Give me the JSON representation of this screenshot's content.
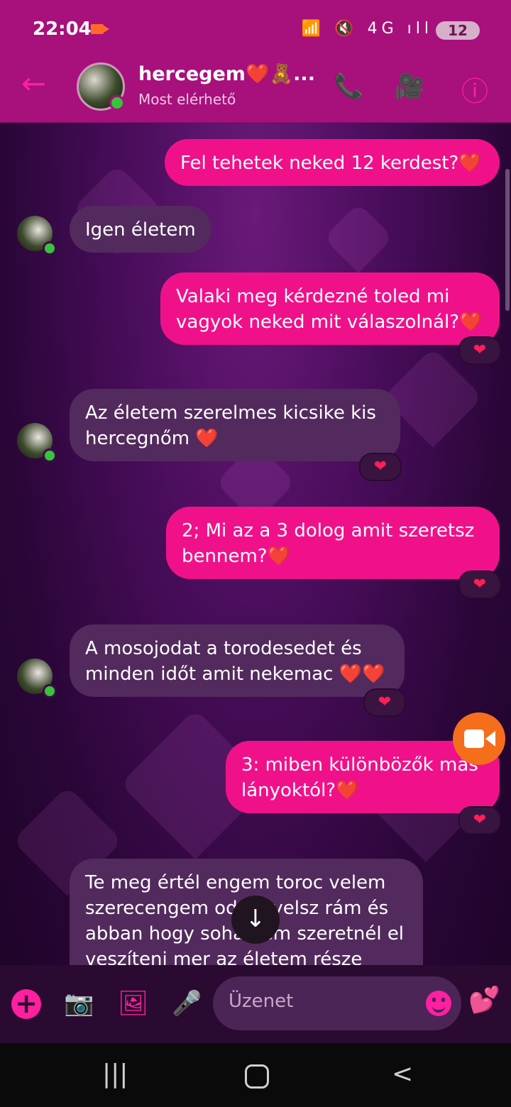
{
  "status": {
    "time": "22:04",
    "icons": "📶 🔇 4G ıll",
    "battery": "12"
  },
  "header": {
    "back_icon": "←",
    "name": "hercegem❤️🧸...",
    "status": "Most elérhető",
    "call_icon": "📞",
    "video_icon": "🎥",
    "info_icon": "ⓘ"
  },
  "messages": [
    {
      "dir": "out",
      "text": "Fel tehetek neked 12 kerdest?❤️"
    },
    {
      "dir": "in",
      "text": "Igen életem"
    },
    {
      "dir": "out",
      "text": "Valaki meg kérdezné toled mi vagyok neked mit válaszolnál?❤️",
      "reaction": "❤"
    },
    {
      "dir": "in",
      "text": "Az életem szerelmes kicsike kis hercegnőm ❤️",
      "reaction": "❤"
    },
    {
      "dir": "out",
      "text": "2;  Mi az a 3 dolog amit szeretsz bennem?❤️",
      "reaction": "❤"
    },
    {
      "dir": "in",
      "text": "A mosojodat a torodesedet és minden időt amit nekemac ❤️❤️",
      "reaction": "❤"
    },
    {
      "dir": "out",
      "text": "3: miben különbözők más lányoktól?❤️",
      "reaction": "❤"
    },
    {
      "dir": "in",
      "text": "Te meg értél engem toroc velem szerecengem odafigyelsz rám és abban hogy soha nem szeretnél el veszíteni mer az életem része"
    }
  ],
  "scroll_down_icon": "↓",
  "compose": {
    "plus_icon": "+",
    "camera_icon": "📷",
    "gallery_icon": "🖼",
    "mic_icon": "🎤",
    "placeholder": "Üzenet",
    "like_icon": "💕"
  },
  "nav": {
    "recents_icon": "|||",
    "back_icon": "<"
  }
}
